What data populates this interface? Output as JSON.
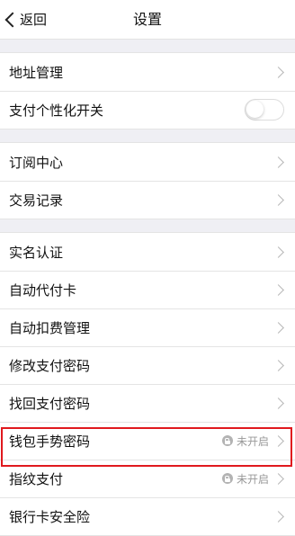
{
  "navbar": {
    "back_label": "返回",
    "title": "设置"
  },
  "groups": [
    {
      "items": [
        {
          "label": "地址管理"
        },
        {
          "label": "支付个性化开关",
          "toggle": "off"
        }
      ]
    },
    {
      "items": [
        {
          "label": "订阅中心"
        },
        {
          "label": "交易记录"
        }
      ]
    },
    {
      "items": [
        {
          "label": "实名认证"
        },
        {
          "label": "自动代付卡"
        },
        {
          "label": "自动扣费管理"
        },
        {
          "label": "修改支付密码"
        },
        {
          "label": "找回支付密码"
        },
        {
          "label": "钱包手势密码",
          "status": "未开启",
          "highlighted": true
        },
        {
          "label": "指纹支付",
          "status": "未开启"
        },
        {
          "label": "银行卡安全险"
        }
      ]
    }
  ],
  "colors": {
    "highlight_border": "#e0191e",
    "background": "#efeff4",
    "row_background": "#ffffff"
  },
  "icons": {
    "back": "chevron-left-icon",
    "row_arrow": "chevron-right-icon",
    "status": "lock-icon"
  }
}
